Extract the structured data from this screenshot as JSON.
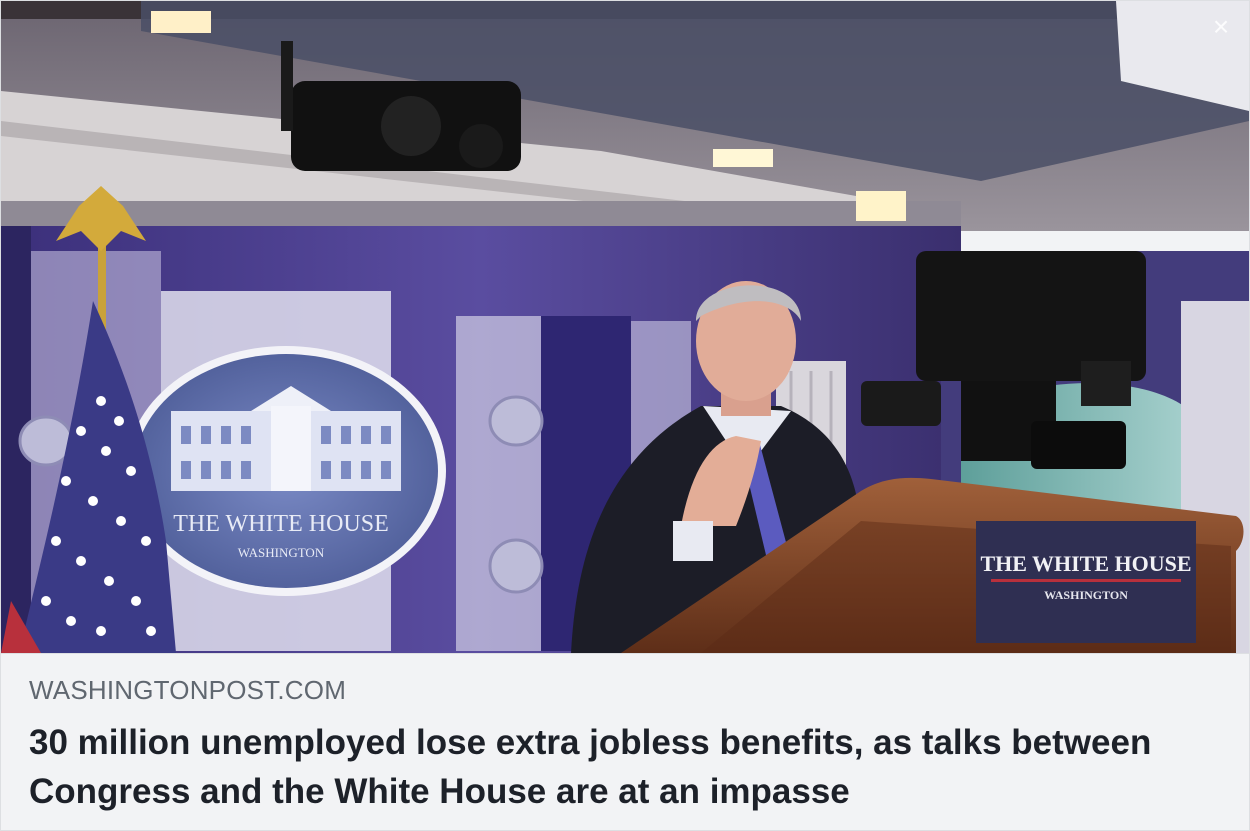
{
  "link_preview": {
    "domain": "WASHINGTONPOST.COM",
    "headline": "30 million unemployed lose extra jobless benefits, as talks between Congress and the White House are at an impasse"
  },
  "photo": {
    "description_icon": "press-briefing-photo",
    "seal_text": "THE WHITE HOUSE",
    "seal_subtext": "WASHINGTON",
    "podium_text": "THE WHITE HOUSE",
    "podium_subtext": "WASHINGTON"
  },
  "controls": {
    "close_glyph": "×",
    "close_icon": "close-icon"
  },
  "colors": {
    "card_background": "#f2f3f5",
    "domain_text": "#606770",
    "headline_text": "#1d2129",
    "seal_blue": "#5a6aa6",
    "backdrop_purple": "#4d3d8f",
    "podium_wood": "#7a3f22"
  }
}
